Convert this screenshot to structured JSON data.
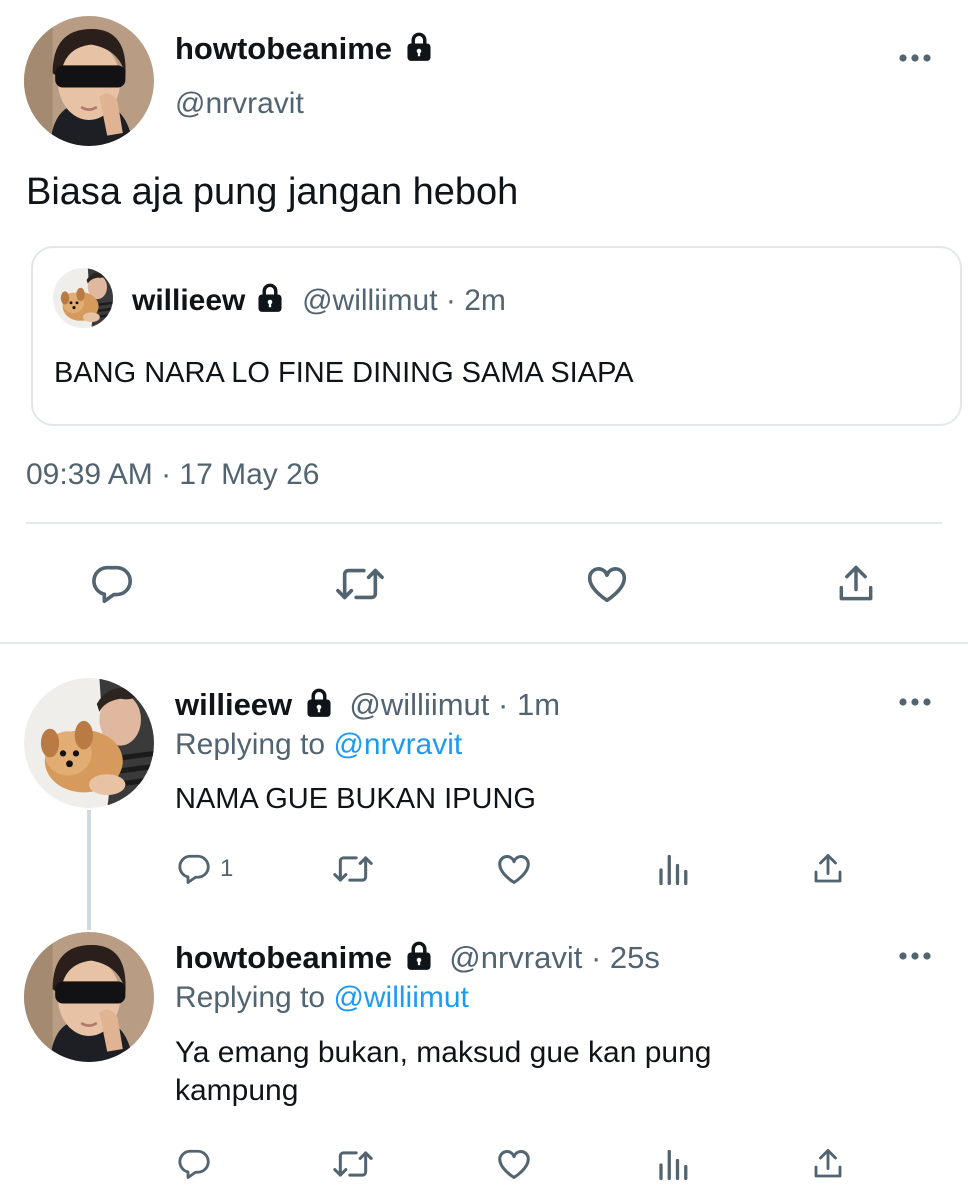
{
  "main_tweet": {
    "display_name": "howtobeanime",
    "handle": "@nrvravit",
    "text": "Biasa aja pung jangan heboh",
    "timestamp": "09:39 AM · 17 May 26",
    "avatar_icon": "avatar-blindfold-person",
    "quoted": {
      "display_name": "willieew",
      "handle": "@williimut",
      "time": "· 2m",
      "text": "BANG NARA LO FINE DINING SAMA SIAPA",
      "avatar_icon": "avatar-person-with-puppy"
    },
    "actions": [
      "reply-icon",
      "retweet-icon",
      "like-icon",
      "share-icon"
    ]
  },
  "replies": [
    {
      "display_name": "willieew",
      "handle": "@williimut",
      "time": "· 1m",
      "replying_prefix": "Replying to",
      "replying_to": "@nrvravit",
      "text": "NAMA GUE BUKAN IPUNG",
      "reply_count": "1",
      "avatar_icon": "avatar-person-with-puppy"
    },
    {
      "display_name": "howtobeanime",
      "handle": "@nrvravit",
      "time": "· 25s",
      "replying_prefix": "Replying to",
      "replying_to": "@williimut",
      "text_line1": "Ya emang bukan, maksud gue kan pung",
      "text_line2": "kampung",
      "reply_count": "",
      "avatar_icon": "avatar-blindfold-person"
    }
  ],
  "colors": {
    "accent": "#1d9bf0",
    "muted": "#536471",
    "icon": "#536471",
    "divider": "#e6e9ec"
  }
}
